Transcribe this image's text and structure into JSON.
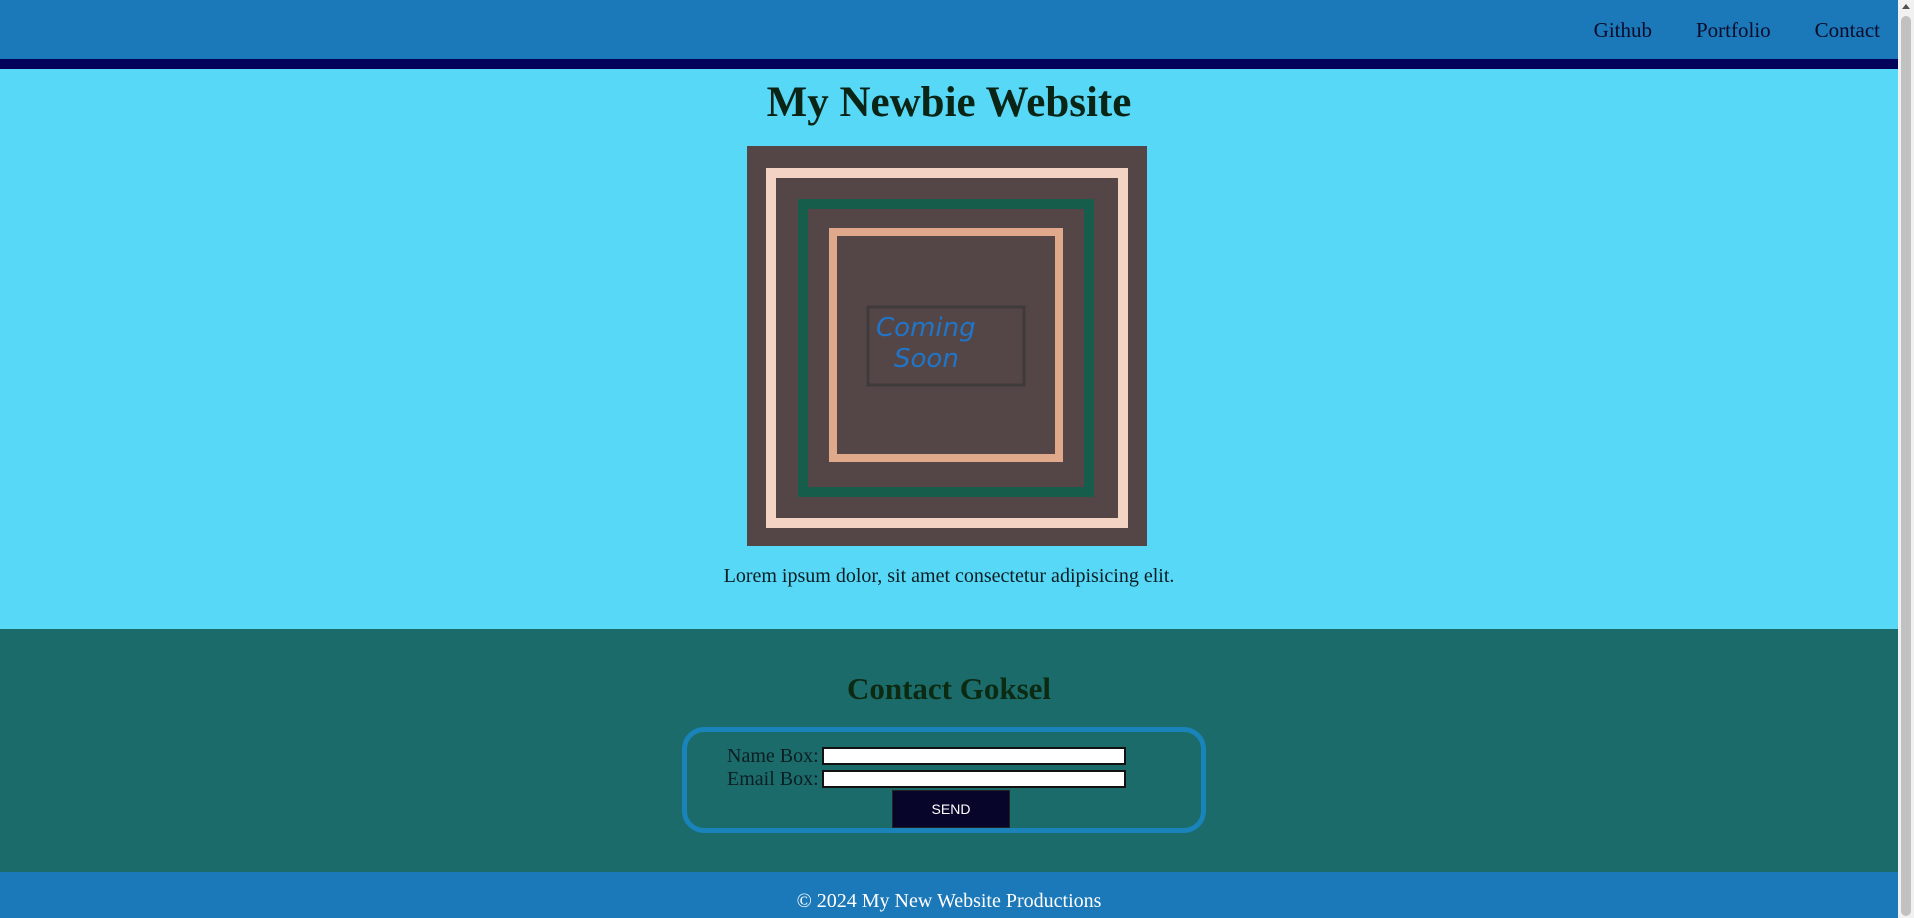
{
  "nav": {
    "links": [
      "Github",
      "Portfolio",
      "Contact"
    ]
  },
  "hero": {
    "title": "My Newbie Website",
    "image_text_line1": "Coming",
    "image_text_line2": "Soon",
    "body_text": "Lorem ipsum dolor, sit amet consectetur adipisicing elit."
  },
  "contact": {
    "title": "Contact Goksel",
    "name_label": "Name Box:",
    "name_value": "",
    "email_label": "Email Box:",
    "email_value": "",
    "send_label": "SEND"
  },
  "footer": {
    "text": "© 2024 My New Website Productions"
  },
  "colors": {
    "nav_bg": "#1b78b9",
    "nav_stripe": "#03035c",
    "hero_bg": "#57d8f7",
    "contact_bg": "#1b6b6b",
    "form_border": "#1a83b9",
    "button_bg": "#07052a"
  }
}
